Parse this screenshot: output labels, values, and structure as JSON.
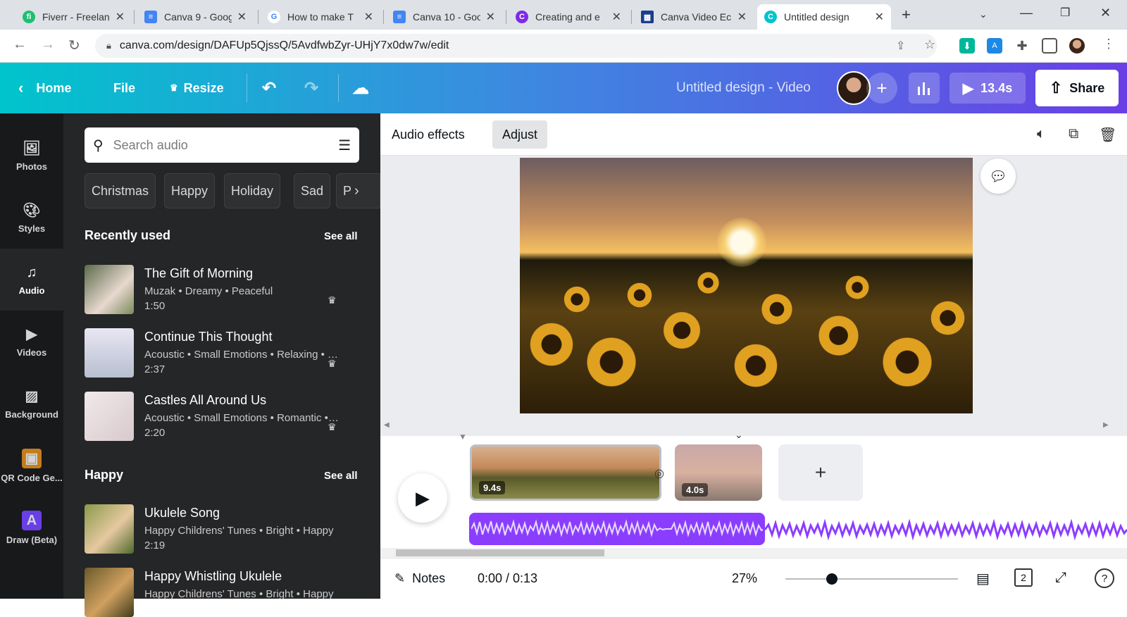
{
  "browser": {
    "tabs": [
      {
        "title": "Fiverr - Freelan",
        "icon_color": "#1dbf73",
        "glyph": "fi"
      },
      {
        "title": "Canva 9 - Goog",
        "icon_color": "#4285f4",
        "glyph": "≡"
      },
      {
        "title": "How to make T",
        "icon_color": "#ffffff",
        "glyph": "G"
      },
      {
        "title": "Canva 10 - Goo",
        "icon_color": "#4285f4",
        "glyph": "≡"
      },
      {
        "title": "Creating and e",
        "icon_color": "#7d2ae8",
        "glyph": "C"
      },
      {
        "title": "Canva Video Ec",
        "icon_color": "#1a3d8f",
        "glyph": "▦"
      },
      {
        "title": "Untitled design",
        "icon_color": "#00c4cc",
        "glyph": "C"
      }
    ],
    "url": "canva.com/design/DAFUp5QjssQ/5AvdfwbZyr-UHjY7x0dw7w/edit"
  },
  "header": {
    "home": "Home",
    "file": "File",
    "resize": "Resize",
    "doc_title": "Untitled design - Video",
    "duration": "13.4s",
    "share": "Share"
  },
  "rail": [
    {
      "label": "Photos",
      "icon": "photos-icon"
    },
    {
      "label": "Styles",
      "icon": "palette-icon"
    },
    {
      "label": "Audio",
      "icon": "music-icon"
    },
    {
      "label": "Videos",
      "icon": "video-icon"
    },
    {
      "label": "Background",
      "icon": "background-icon"
    },
    {
      "label": "QR Code Ge...",
      "icon": "qr-code-icon"
    },
    {
      "label": "Draw (Beta)",
      "icon": "draw-icon"
    }
  ],
  "panel": {
    "search_placeholder": "Search audio",
    "chips": [
      "Christmas",
      "Happy",
      "Holiday",
      "Sad",
      "P"
    ],
    "recent_heading": "Recently used",
    "happy_heading": "Happy",
    "see_all": "See all",
    "recent": [
      {
        "name": "The Gift of Morning",
        "meta": "Muzak • Dreamy • Peaceful",
        "duration": "1:50"
      },
      {
        "name": "Continue This Thought",
        "meta": "Acoustic • Small Emotions • Relaxing • Peaceful",
        "duration": "2:37"
      },
      {
        "name": "Castles All Around Us",
        "meta": "Acoustic • Small Emotions • Romantic • Dreamy",
        "duration": "2:20"
      }
    ],
    "happy": [
      {
        "name": "Ukulele Song",
        "meta": "Happy Childrens' Tunes • Bright • Happy",
        "duration": "2:19"
      },
      {
        "name": "Happy Whistling Ukulele",
        "meta": "Happy Childrens' Tunes • Bright • Happy",
        "duration": ""
      }
    ]
  },
  "context": {
    "audio_effects": "Audio effects",
    "adjust": "Adjust"
  },
  "timeline": {
    "clip1_duration": "9.4s",
    "clip2_duration": "4.0s"
  },
  "footer": {
    "notes": "Notes",
    "time": "0:00 / 0:13",
    "zoom": "27%",
    "zoom_fraction": 0.27,
    "pages": "2"
  }
}
